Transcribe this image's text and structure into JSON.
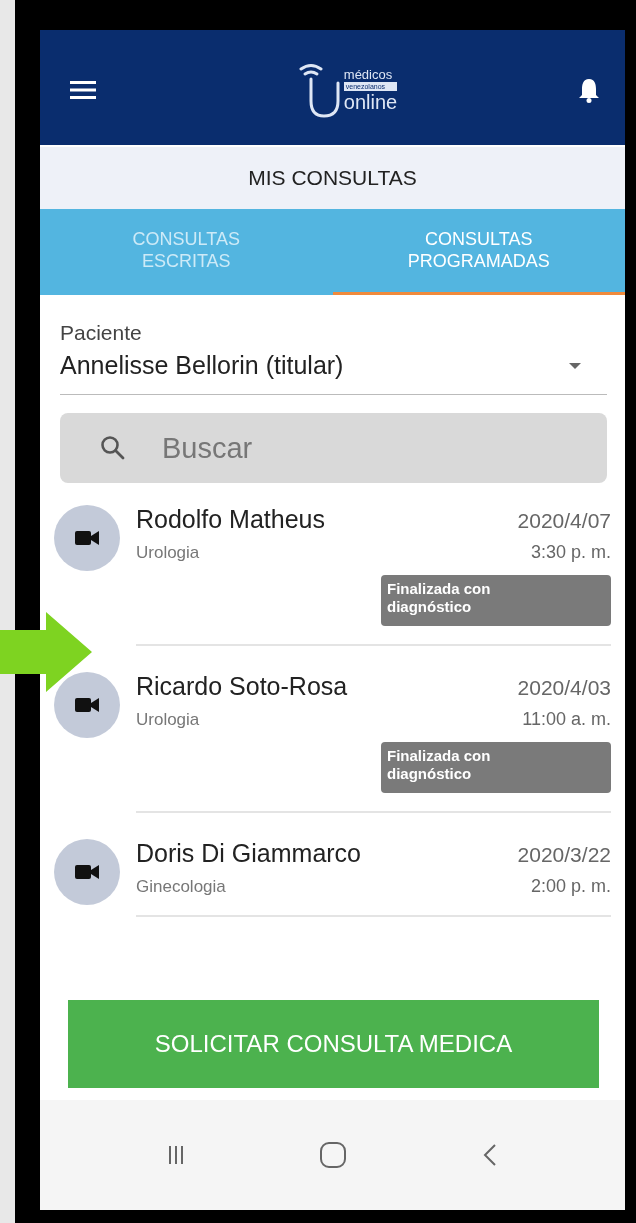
{
  "header": {
    "logo": {
      "line_1": "médicos",
      "line_2": "venezolanos",
      "line_3": "online"
    }
  },
  "page_title": "MIS CONSULTAS",
  "tabs": [
    {
      "label": "CONSULTAS ESCRITAS",
      "selected": false
    },
    {
      "label": "CONSULTAS PROGRAMADAS",
      "selected": true
    }
  ],
  "patient": {
    "label": "Paciente",
    "value": "Annelisse Bellorin (titular)"
  },
  "search": {
    "placeholder": "Buscar"
  },
  "consultations": [
    {
      "doctor": "Rodolfo Matheus",
      "specialty": "Urologia",
      "date": "2020/4/07",
      "time": "3:30 p. m.",
      "status": "Finalizada con diagnóstico"
    },
    {
      "doctor": "Ricardo Soto-Rosa",
      "specialty": "Urologia",
      "date": "2020/4/03",
      "time": "11:00 a. m.",
      "status": "Finalizada con diagnóstico"
    },
    {
      "doctor": "Doris Di Giammarco",
      "specialty": "Ginecologia",
      "date": "2020/3/22",
      "time": "2:00 p. m."
    }
  ],
  "primary_button": "SOLICITAR CONSULTA MEDICA"
}
